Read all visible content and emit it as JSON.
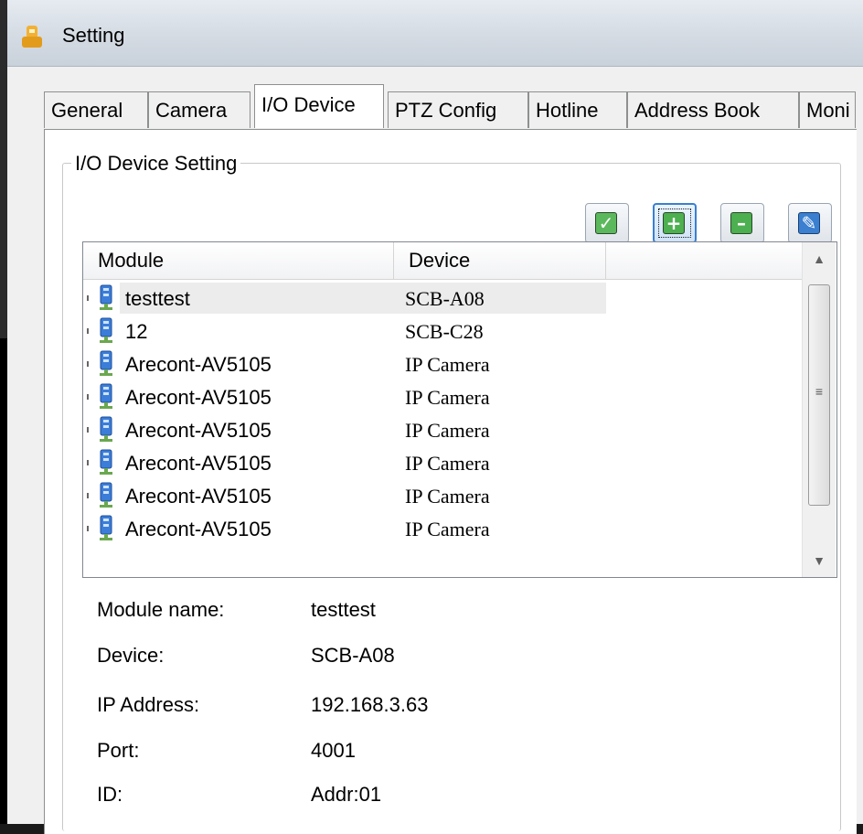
{
  "window": {
    "title": "Setting"
  },
  "tabs": [
    "General",
    "Camera",
    "I/O Device",
    "PTZ Config",
    "Hotline",
    "Address Book",
    "Moni"
  ],
  "group": {
    "title": "I/O Device Setting"
  },
  "toolbar": {
    "confirm_icon": "checkmark-icon",
    "add_icon": "plus-icon",
    "remove_icon": "minus-icon",
    "edit_icon": "pencil-icon"
  },
  "list": {
    "columns": [
      "Module",
      "Device"
    ],
    "rows": [
      {
        "module": "testtest",
        "device": "SCB-A08"
      },
      {
        "module": "12",
        "device": "SCB-C28"
      },
      {
        "module": "Arecont-AV5105",
        "device": "IP Camera"
      },
      {
        "module": "Arecont-AV5105",
        "device": "IP Camera"
      },
      {
        "module": "Arecont-AV5105",
        "device": "IP Camera"
      },
      {
        "module": "Arecont-AV5105",
        "device": "IP Camera"
      },
      {
        "module": "Arecont-AV5105",
        "device": "IP Camera"
      },
      {
        "module": "Arecont-AV5105",
        "device": "IP Camera"
      }
    ]
  },
  "details": {
    "module_name_label": "Module name:",
    "module_name_value": "testtest",
    "device_label": "Device:",
    "device_value": "SCB-A08",
    "ip_label": "IP Address:",
    "ip_value": "192.168.3.63",
    "port_label": "Port:",
    "port_value": "4001",
    "id_label": "ID:",
    "id_value": "Addr:01"
  },
  "colors": {
    "confirm": "#5cb85c",
    "add": "#4caf50",
    "remove": "#4caf50",
    "edit": "#3a7fd0"
  }
}
